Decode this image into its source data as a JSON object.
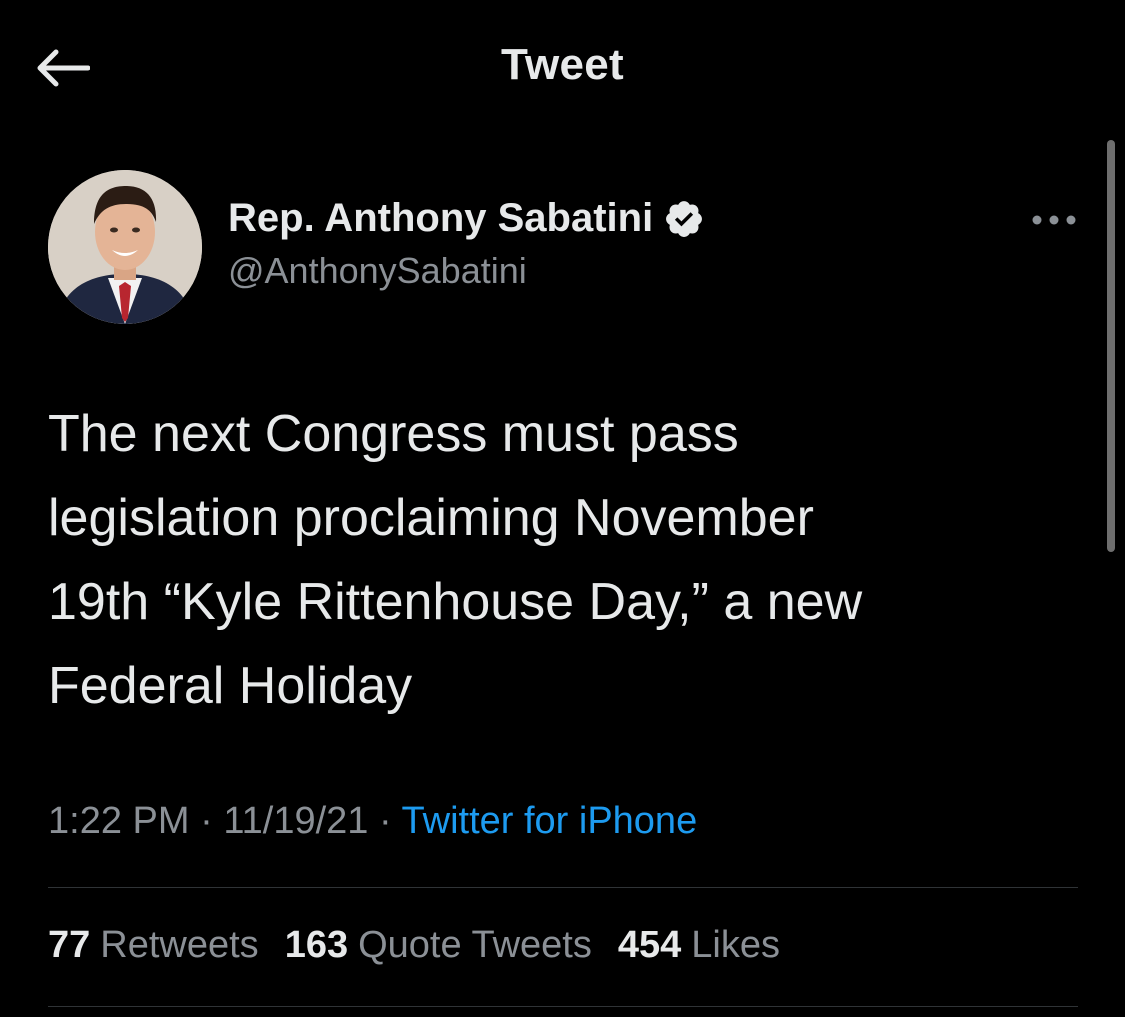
{
  "header": {
    "title": "Tweet",
    "back_icon": "arrow-left-icon"
  },
  "author": {
    "name": "Rep. Anthony Sabatini",
    "handle": "@AnthonySabatini",
    "verified_icon": "verified-badge-icon"
  },
  "tweet": {
    "text": "The next Congress must pass\nlegislation proclaiming November\n19th “Kyle Rittenhouse Day,” a new\nFederal Holiday",
    "time": "1:22 PM",
    "date": "11/19/21",
    "source": "Twitter for iPhone",
    "separator": " · "
  },
  "stats": {
    "retweets_count": "77",
    "retweets_label": "Retweets",
    "quotes_count": "163",
    "quotes_label": "Quote Tweets",
    "likes_count": "454",
    "likes_label": "Likes"
  },
  "colors": {
    "background": "#000000",
    "text": "#e7e9ea",
    "secondary": "#8b9096",
    "link": "#1d9bf0",
    "divider": "#2f3336"
  }
}
